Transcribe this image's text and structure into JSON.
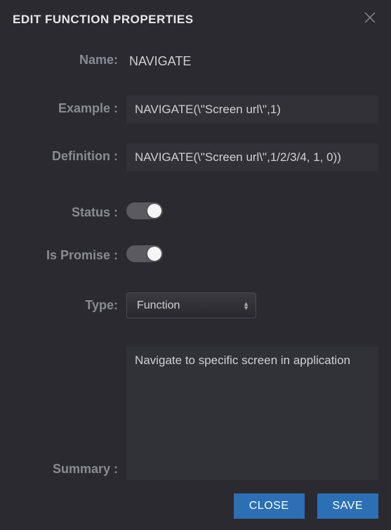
{
  "header": {
    "title": "EDIT FUNCTION PROPERTIES"
  },
  "labels": {
    "name": "Name:",
    "example": "Example :",
    "definition": "Definition :",
    "status": "Status :",
    "is_promise": "Is Promise :",
    "type": "Type:",
    "summary": "Summary :"
  },
  "values": {
    "name": "NAVIGATE",
    "example": "NAVIGATE(\\\"Screen url\\\",1)",
    "definition": "NAVIGATE(\\\"Screen url\\\",1/2/3/4, 1, 0))",
    "status_on": true,
    "is_promise_on": true,
    "type_selected": "Function",
    "summary": "Navigate to specific screen in application"
  },
  "type_options": [
    "Function"
  ],
  "buttons": {
    "close": "CLOSE",
    "save": "SAVE"
  }
}
